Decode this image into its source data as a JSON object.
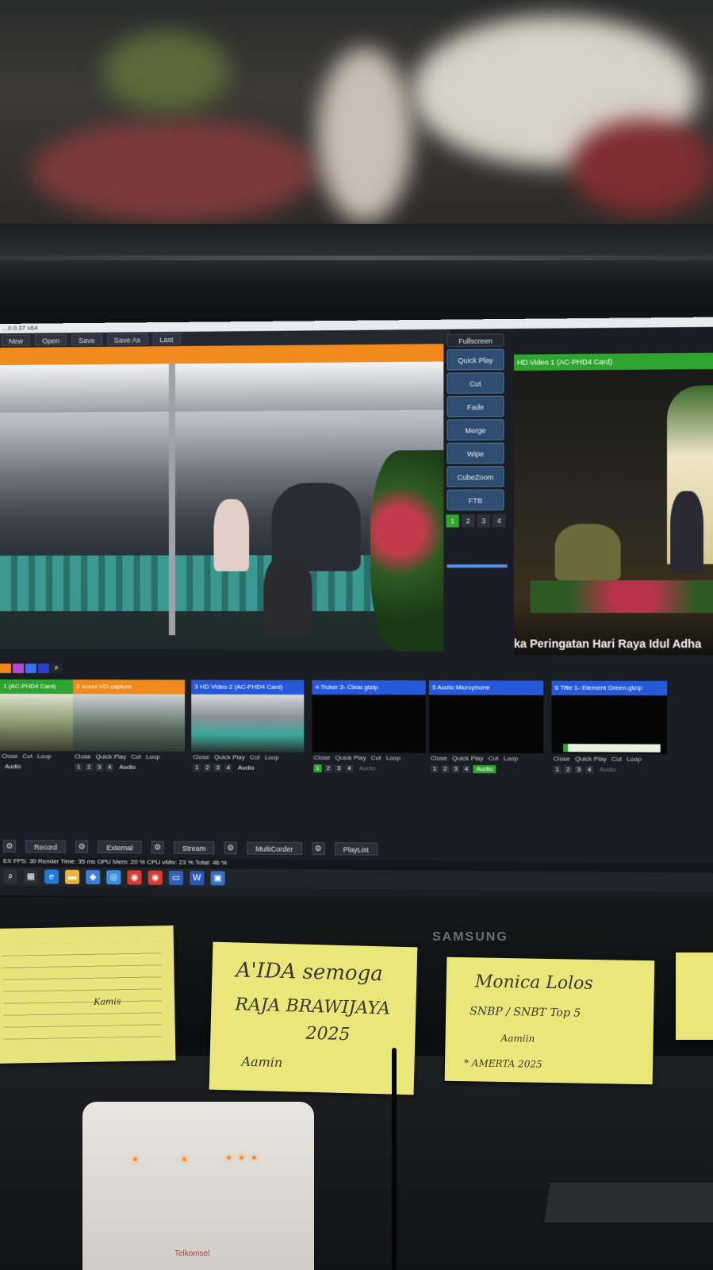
{
  "app": {
    "title": "…0.0.37 x64",
    "menu": [
      "New",
      "Open",
      "Save",
      "Save As",
      "Last"
    ],
    "fullscreen_label": "Fullscreen"
  },
  "transitions": {
    "buttons": [
      "Quick Play",
      "Cut",
      "Fade",
      "Merge",
      "Wipe",
      "CubeZoom",
      "FTB"
    ],
    "numbers": [
      "1",
      "2",
      "3",
      "4"
    ]
  },
  "output": {
    "title": "HD Video 1 (AC-PHD4 Card)",
    "ticker": "ka Peringatan Hari Raya Idul Adha"
  },
  "inputs": [
    {
      "num": "1",
      "title": "(AC-PHD4 Card)",
      "color": "#2ea52e"
    },
    {
      "num": "2",
      "title": "xxxxx HD capture",
      "color": "#f08a1c"
    },
    {
      "num": "3",
      "title": "HD Video 2 (AC-PHD4 Card)",
      "color": "#2659d9"
    },
    {
      "num": "4",
      "title": "Ticker 3- Clear.gtzip",
      "color": "#2659d9"
    },
    {
      "num": "5",
      "title": "Audio Microphone",
      "color": "#2659d9"
    },
    {
      "num": "6",
      "title": "Title 1- Element Green.gtzip",
      "color": "#2659d9"
    }
  ],
  "input_controls": {
    "close": "Close",
    "quick_play": "Quick Play",
    "cut": "Cut",
    "loop": "Loop",
    "audio": "Audio"
  },
  "bottom": {
    "record": "Record",
    "external": "External",
    "stream": "Stream",
    "multicorder": "MultiCorder",
    "playlist": "PlayList"
  },
  "status": "EX FPS: 30 Render Time: 35 ms GPU Mem: 20 % CPU vMix: 23 % Total: 46 %",
  "monitor_brand": "SAMSUNG",
  "notes": {
    "note2_line1": "A'IDA semoga",
    "note2_line2": "RAJA BRAWIJAYA",
    "note2_line3": "2025",
    "note2_line4": "Aamin",
    "note3_line1": "Monica Lolos",
    "note3_line2": "SNBP / SNBT Top 5",
    "note3_line3": "Aamiin",
    "note3_line4": "* AMERTA 2025",
    "note1_line1": "Kamis"
  },
  "router_label": "Telkomsel"
}
